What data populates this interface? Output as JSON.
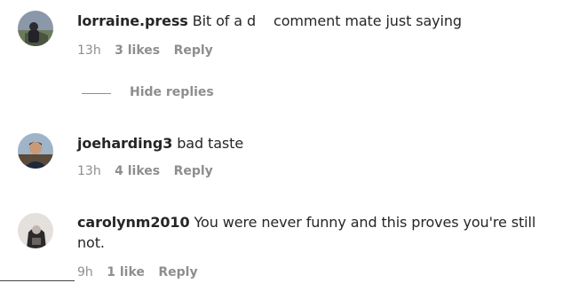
{
  "comments": [
    {
      "username": "lorraine.press",
      "text_a": "Bit of a d",
      "text_b": "comment mate just saying",
      "time": "13h",
      "likes": "3 likes",
      "reply": "Reply",
      "avatar_colors": [
        "#7a8aa0",
        "#2e3440"
      ]
    },
    {
      "username": "joeharding3",
      "text": "bad taste",
      "time": "13h",
      "likes": "4 likes",
      "reply": "Reply",
      "avatar_colors": [
        "#8aa0b8",
        "#3a2e28"
      ]
    },
    {
      "username": "carolynm2010",
      "text": "You were never funny and this proves you're still not.",
      "time": "9h",
      "likes": "1 like",
      "reply": "Reply",
      "avatar_colors": [
        "#d8d4d0",
        "#3a3a3a"
      ]
    }
  ],
  "hide_replies_label": "Hide replies"
}
